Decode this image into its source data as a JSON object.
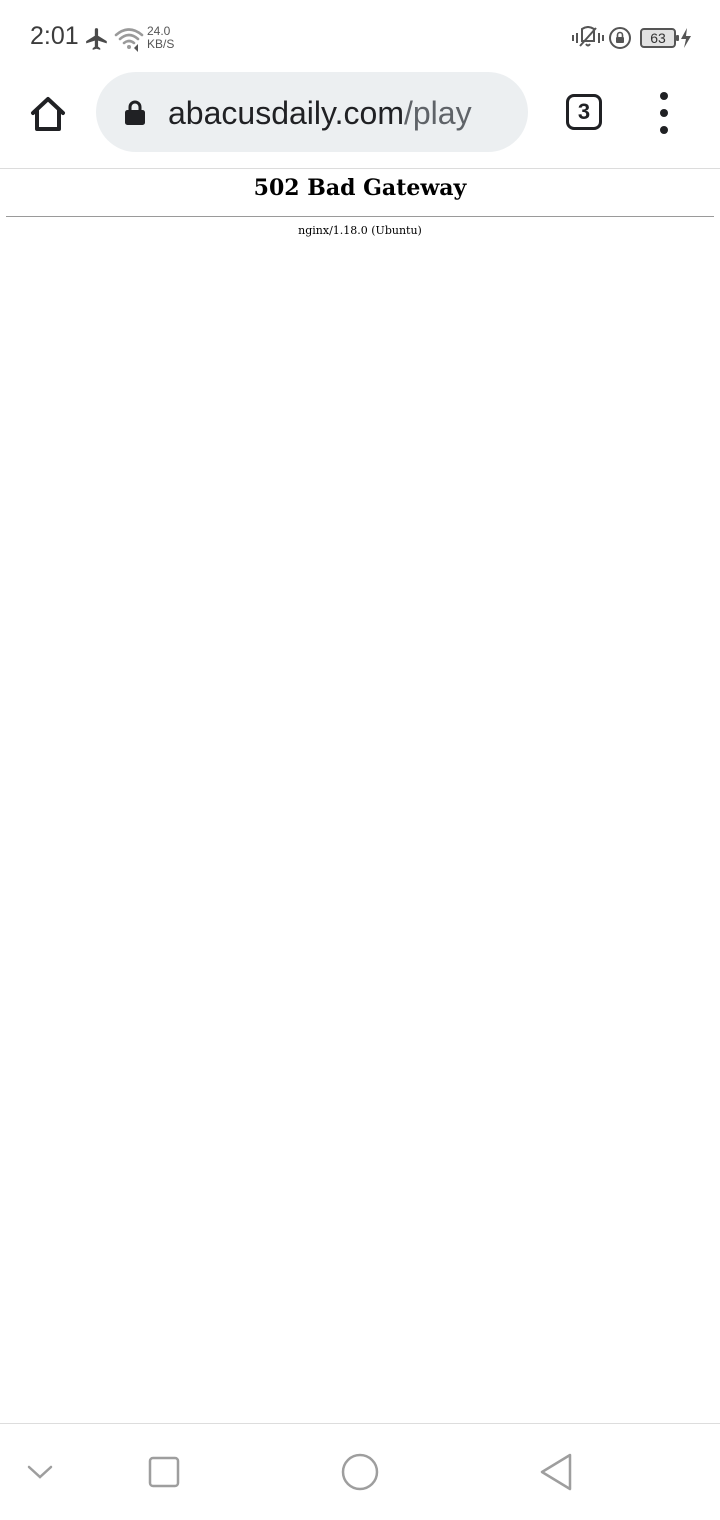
{
  "status_bar": {
    "time": "2:01",
    "net_speed_value": "24.0",
    "net_speed_unit": "KB/S",
    "battery_level": "63",
    "icons": [
      "airplane-mode-icon",
      "wifi-icon",
      "vibrate-icon",
      "rotation-lock-icon",
      "battery-icon",
      "charging-icon"
    ]
  },
  "browser": {
    "url_host": "abacusdaily.com",
    "url_path": "/play",
    "tab_count": "3",
    "icons": [
      "home-icon",
      "lock-icon",
      "tab-switcher-icon",
      "more-options-icon"
    ]
  },
  "page": {
    "title": "502 Bad Gateway",
    "server": "nginx/1.18.0 (Ubuntu)"
  },
  "nav_bar": {
    "icons": [
      "hide-nav-chevron-icon",
      "recents-icon",
      "home-circle-icon",
      "back-icon"
    ]
  },
  "colors": {
    "text_primary": "#202124",
    "omnibox_bg": "#eceff1",
    "url_path": "#5f6368",
    "status_text": "#3c3c3c"
  }
}
